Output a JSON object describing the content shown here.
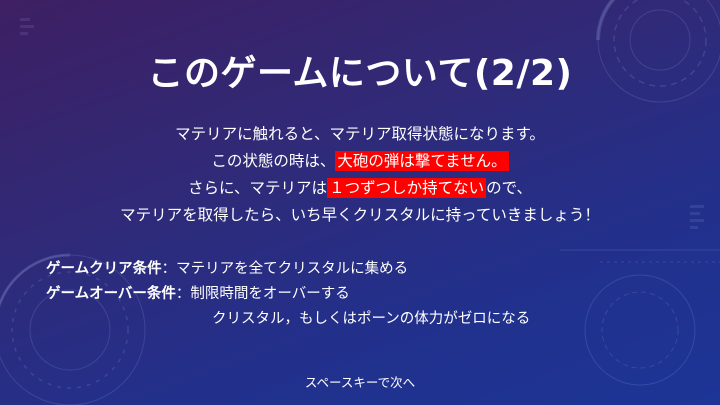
{
  "slide": {
    "title": "このゲームについて(2/2)",
    "paragraph": {
      "line1": "マテリアに触れると、マテリア取得状態になります。",
      "line2_pre": "この状態の時は、",
      "line2_highlight": "大砲の弾は撃てません。",
      "line3_pre": "さらに、マテリアは",
      "line3_highlight": "１つずつしか持てない",
      "line3_post": "ので、",
      "line4": "マテリアを取得したら、いち早くクリスタルに持っていきましょう！"
    },
    "conditions": {
      "clear_label": "ゲームクリア条件",
      "clear_sep": "：",
      "clear_text": "マテリアを全てクリスタルに集める",
      "over_label": "ゲームオーバー条件",
      "over_sep": "：",
      "over_text1": "制限時間をオーバーする",
      "over_text2": "クリスタル，もしくはポーンの体力がゼロになる"
    },
    "footer": "スペースキーで次へ"
  },
  "colors": {
    "highlight": "#ff0000",
    "text": "#ffffff"
  }
}
